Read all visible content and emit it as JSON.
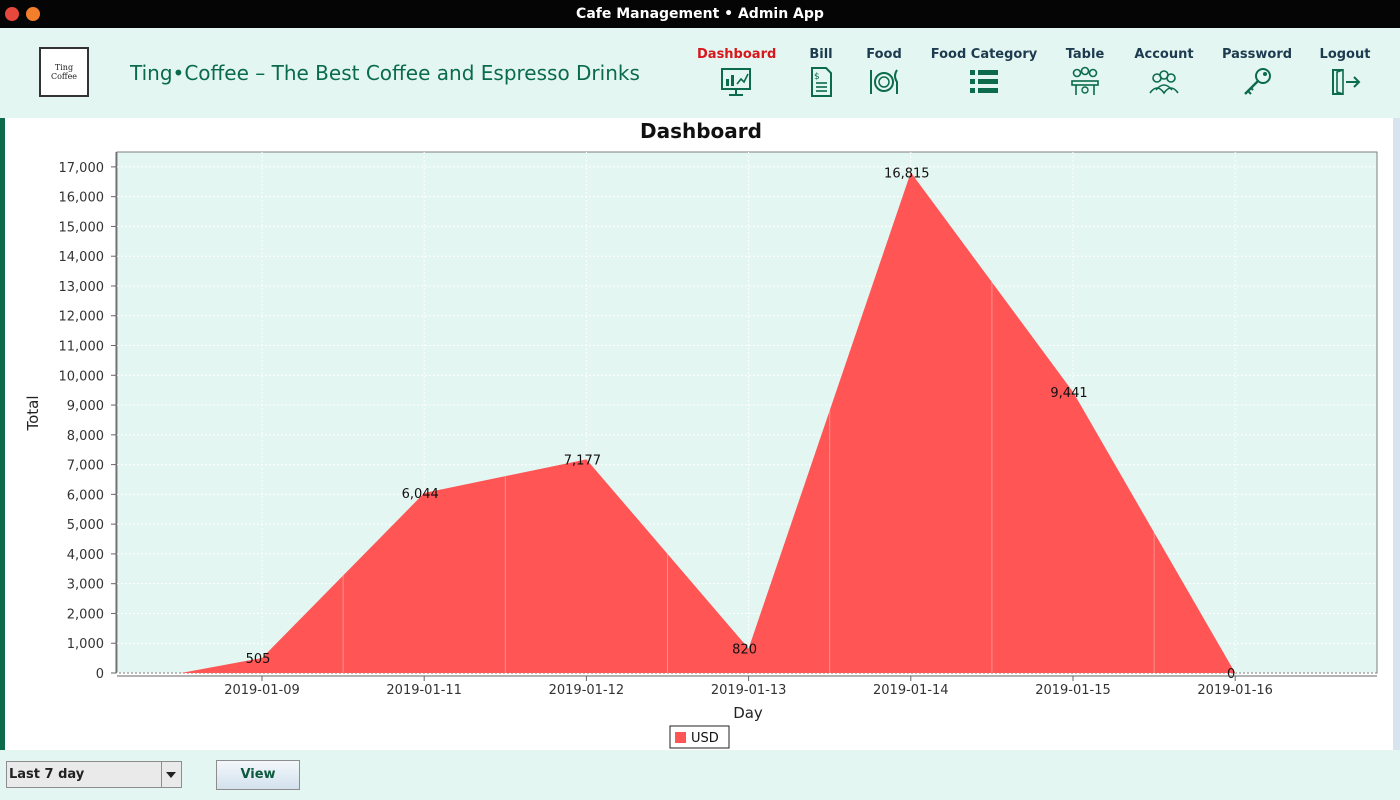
{
  "window": {
    "title": "Cafe Management • Admin App"
  },
  "header": {
    "logo_line1": "Ting",
    "logo_line2": "Coffee",
    "app_name": "Ting•Coffee – The Best Coffee and Espresso Drinks",
    "nav": [
      {
        "label": "Dashboard",
        "icon": "dashboard-icon",
        "active": true
      },
      {
        "label": "Bill",
        "icon": "bill-icon"
      },
      {
        "label": "Food",
        "icon": "food-icon"
      },
      {
        "label": "Food Category",
        "icon": "list-icon"
      },
      {
        "label": "Table",
        "icon": "table-icon"
      },
      {
        "label": "Account",
        "icon": "account-icon"
      },
      {
        "label": "Password",
        "icon": "key-icon"
      },
      {
        "label": "Logout",
        "icon": "logout-icon"
      }
    ]
  },
  "colors": {
    "accent": "#0b6b4a",
    "active_nav": "#d8161c",
    "series": "#ff5555",
    "plot_bg": "#e4f6f1"
  },
  "chart_data": {
    "type": "area",
    "title": "Dashboard",
    "xlabel": "Day",
    "ylabel": "Total",
    "x": [
      "2019-01-09",
      "2019-01-11",
      "2019-01-12",
      "2019-01-13",
      "2019-01-14",
      "2019-01-15",
      "2019-01-16"
    ],
    "series": [
      {
        "name": "USD",
        "values": [
          505,
          6044,
          7177,
          820,
          16815,
          9441,
          0
        ]
      }
    ],
    "data_labels": [
      "505",
      "6,044",
      "7,177",
      "820",
      "16,815",
      "9,441",
      "0"
    ],
    "ylim": [
      0,
      17500
    ],
    "yticks": [
      0,
      1000,
      2000,
      3000,
      4000,
      5000,
      6000,
      7000,
      8000,
      9000,
      10000,
      11000,
      12000,
      13000,
      14000,
      15000,
      16000,
      17000
    ],
    "ytick_labels": [
      "0",
      "1,000",
      "2,000",
      "3,000",
      "4,000",
      "5,000",
      "6,000",
      "7,000",
      "8,000",
      "9,000",
      "10,000",
      "11,000",
      "12,000",
      "13,000",
      "14,000",
      "15,000",
      "16,000",
      "17,000"
    ],
    "grid": true,
    "legend": "bottom-center"
  },
  "footer": {
    "range_value": "Last 7 day",
    "view_label": "View"
  }
}
